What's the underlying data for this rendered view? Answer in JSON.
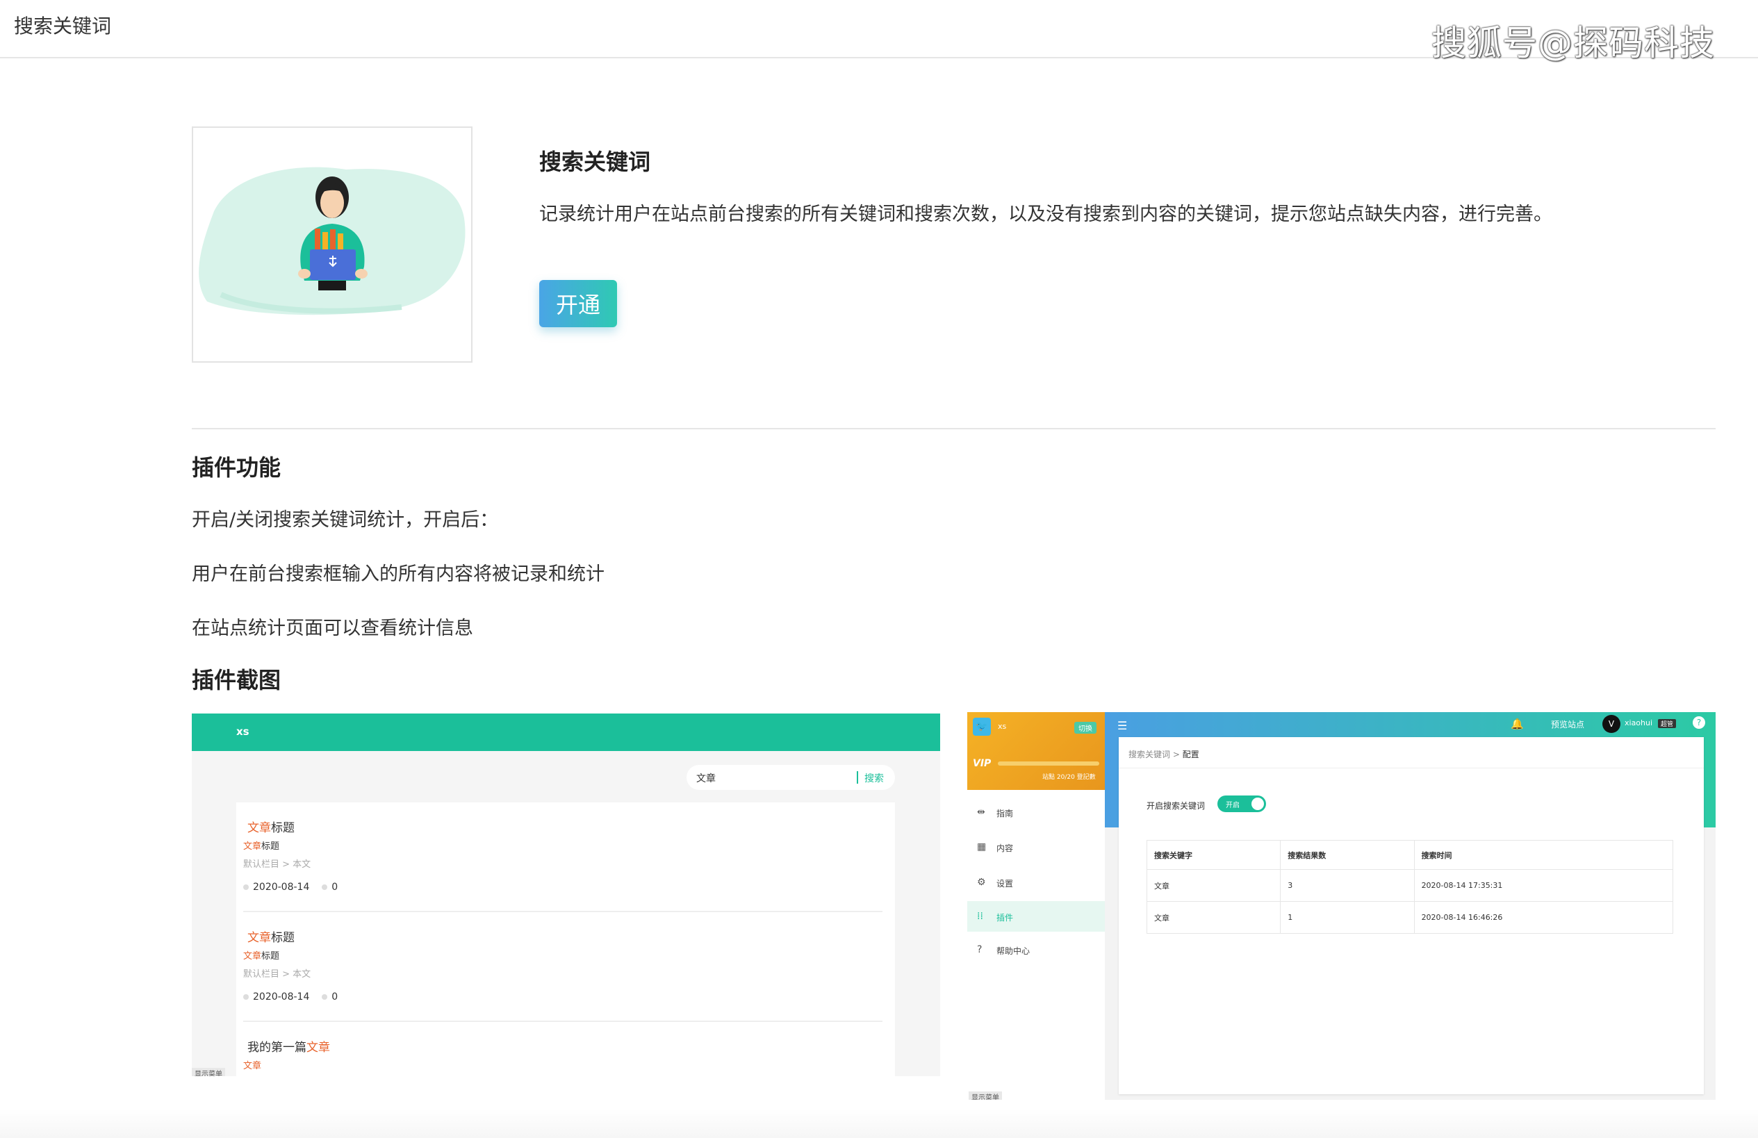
{
  "header": {
    "title": "搜索关键词",
    "watermark": "搜狐号@探码科技"
  },
  "intro": {
    "title": "搜索关键词",
    "description": "记录统计用户在站点前台搜索的所有关键词和搜索次数，以及没有搜索到内容的关键词，提示您站点缺失内容，进行完善。",
    "open_button": "开通"
  },
  "features": {
    "title": "插件功能",
    "lines": [
      "开启/关闭搜索关键词统计，开启后：",
      "用户在前台搜索框输入的所有内容将被记录和统计",
      "在站点统计页面可以查看统计信息"
    ]
  },
  "screenshots": {
    "title": "插件截图",
    "front": {
      "site_name": "xs",
      "search_value": "文章",
      "search_button": "搜索",
      "items": [
        {
          "title_hl": "文章",
          "title_rest": "标题",
          "sub_hl": "文章",
          "sub_rest": "标题",
          "category": "默认栏目 > 本文",
          "date": "2020-08-14",
          "count": "0"
        },
        {
          "title_hl": "文章",
          "title_rest": "标题",
          "sub_hl": "文章",
          "sub_rest": "标题",
          "category": "默认栏目 > 本文",
          "date": "2020-08-14",
          "count": "0"
        },
        {
          "title_pre": "我的第一篇",
          "title_hl": "文章",
          "sub_hl": "文章"
        }
      ],
      "corner_tag": "显示菜单"
    },
    "admin": {
      "site_name": "xs",
      "switch_label": "切换",
      "vip": "VIP",
      "vip_info": "站點 20/20 登記數",
      "menu": [
        {
          "icon": "guide-icon",
          "glyph": "⇹",
          "label": "指南"
        },
        {
          "icon": "grid-icon",
          "glyph": "▦",
          "label": "内容"
        },
        {
          "icon": "gear-icon",
          "glyph": "⚙",
          "label": "设置"
        },
        {
          "icon": "apps-icon",
          "glyph": "⁞⁞",
          "label": "插件"
        },
        {
          "icon": "help-icon",
          "glyph": "?",
          "label": "帮助中心"
        }
      ],
      "side_tag": "显示菜单",
      "preview_site": "预览站点",
      "username": "xiaohui",
      "role": "超管",
      "breadcrumb": {
        "parent": "搜索关键词",
        "sep": ">",
        "current": "配置"
      },
      "toggle_label": "开启搜索关键词",
      "toggle_state": "开启",
      "table": {
        "headers": [
          "搜索关键字",
          "搜索结果数",
          "搜索时间"
        ],
        "rows": [
          [
            "文章",
            "3",
            "2020-08-14 17:35:31"
          ],
          [
            "文章",
            "1",
            "2020-08-14 16:46:26"
          ]
        ]
      }
    }
  },
  "colors": {
    "accent": "#1bbf9a",
    "button_gradient": [
      "#4aa5e6",
      "#2fc9b3"
    ],
    "highlight": "#e8632c",
    "vip": "#f5b226"
  }
}
